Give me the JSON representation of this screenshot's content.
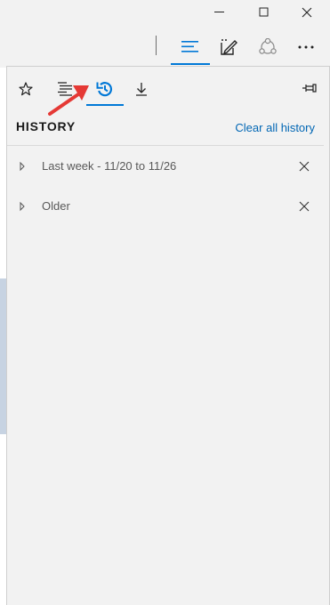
{
  "window_controls": {
    "minimize_icon": "minimize-icon",
    "maximize_icon": "maximize-icon",
    "close_icon": "close-icon"
  },
  "toolbar": {
    "icons": [
      "hub-icon",
      "web-note-icon",
      "share-icon",
      "more-icon"
    ],
    "accent_color": "#0078d7"
  },
  "hub_panel": {
    "tabs": [
      {
        "name": "favorites",
        "icon": "star-icon"
      },
      {
        "name": "reading-list",
        "icon": "reading-list-icon"
      },
      {
        "name": "history",
        "icon": "history-icon",
        "active": true
      },
      {
        "name": "downloads",
        "icon": "download-icon"
      }
    ],
    "pin_icon": "pin-icon",
    "title": "HISTORY",
    "clear_label": "Clear all history",
    "groups": [
      {
        "label": "Last week - 11/20 to 11/26"
      },
      {
        "label": "Older"
      }
    ]
  },
  "annotation": {
    "color": "#e53935",
    "icon": "red-arrow"
  }
}
